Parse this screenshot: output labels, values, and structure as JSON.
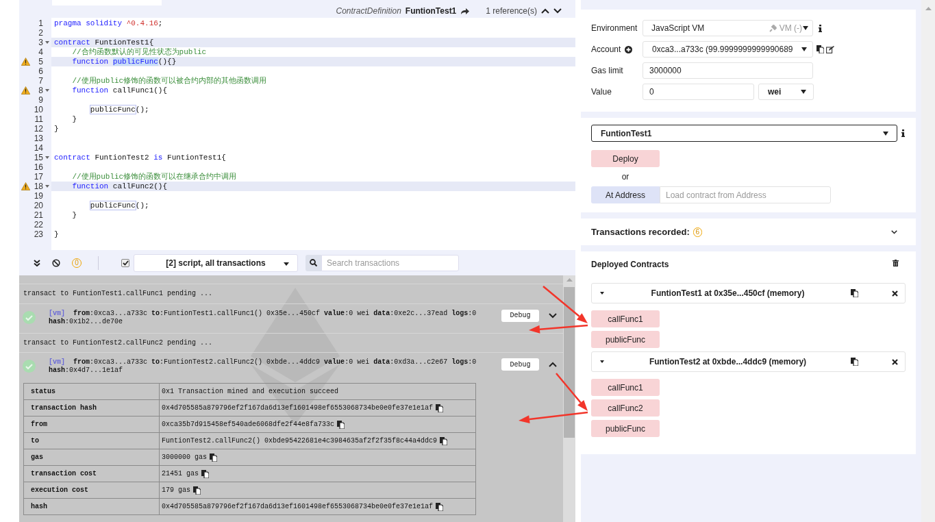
{
  "editor": {
    "header": {
      "kind_label": "ContractDefinition",
      "name": "FuntionTest1",
      "references": "1 reference(s)"
    },
    "lines": [
      {
        "number": "1",
        "warning": false,
        "fold": false,
        "highlighted": false,
        "tokens": [
          {
            "kind": "keyword",
            "text": "pragma solidity "
          },
          {
            "kind": "number",
            "text": "^0.4.16"
          },
          {
            "kind": "plain",
            "text": ";"
          }
        ]
      },
      {
        "number": "2",
        "warning": false,
        "fold": false,
        "highlighted": false
      },
      {
        "number": "3",
        "warning": false,
        "fold": true,
        "highlighted": true,
        "tokens": [
          {
            "kind": "keyword",
            "text": "contract "
          },
          {
            "kind": "plain",
            "text": "FuntionTest1{"
          }
        ]
      },
      {
        "number": "4",
        "warning": false,
        "fold": false,
        "highlighted": false,
        "tokens": [
          {
            "kind": "comment",
            "text": "    //合约函数默认的可见性状态为public"
          }
        ]
      },
      {
        "number": "5",
        "warning": true,
        "fold": false,
        "highlighted": true,
        "tokens": [
          {
            "kind": "keyword",
            "text": "    function "
          },
          {
            "kind": "selected",
            "text": "publicFunc"
          },
          {
            "kind": "plain",
            "text": "(){}"
          }
        ]
      },
      {
        "number": "6",
        "warning": false,
        "fold": false,
        "highlighted": false
      },
      {
        "number": "7",
        "warning": false,
        "fold": false,
        "highlighted": false,
        "tokens": [
          {
            "kind": "comment",
            "text": "    //使用public修饰的函数可以被合约内部的其他函数调用"
          }
        ]
      },
      {
        "number": "8",
        "warning": true,
        "fold": true,
        "highlighted": false,
        "tokens": [
          {
            "kind": "keyword",
            "text": "    function "
          },
          {
            "kind": "plain",
            "text": "callFunc1(){"
          }
        ]
      },
      {
        "number": "9",
        "warning": false,
        "fold": false,
        "highlighted": false
      },
      {
        "number": "10",
        "warning": false,
        "fold": false,
        "highlighted": false,
        "tokens": [
          {
            "kind": "occurrence",
            "text": "        publicFunc"
          },
          {
            "kind": "plain",
            "text": "();"
          }
        ]
      },
      {
        "number": "11",
        "warning": false,
        "fold": false,
        "highlighted": false,
        "tokens": [
          {
            "kind": "plain",
            "text": "    }"
          }
        ]
      },
      {
        "number": "12",
        "warning": false,
        "fold": false,
        "highlighted": false,
        "tokens": [
          {
            "kind": "plain",
            "text": "}"
          }
        ]
      },
      {
        "number": "13",
        "warning": false,
        "fold": false,
        "highlighted": false
      },
      {
        "number": "14",
        "warning": false,
        "fold": false,
        "highlighted": false
      },
      {
        "number": "15",
        "warning": false,
        "fold": true,
        "highlighted": false,
        "tokens": [
          {
            "kind": "keyword",
            "text": "contract "
          },
          {
            "kind": "plain",
            "text": "FuntionTest2 "
          },
          {
            "kind": "keyword",
            "text": "is "
          },
          {
            "kind": "plain",
            "text": "FuntionTest1{"
          }
        ]
      },
      {
        "number": "16",
        "warning": false,
        "fold": false,
        "highlighted": false
      },
      {
        "number": "17",
        "warning": false,
        "fold": false,
        "highlighted": false,
        "tokens": [
          {
            "kind": "comment",
            "text": "    //使用public修饰的函数可以在继承合约中调用"
          }
        ]
      },
      {
        "number": "18",
        "warning": true,
        "fold": true,
        "highlighted": true,
        "tokens": [
          {
            "kind": "keyword",
            "text": "    function "
          },
          {
            "kind": "plain",
            "text": "callFunc2(){"
          }
        ]
      },
      {
        "number": "19",
        "warning": false,
        "fold": false,
        "highlighted": false
      },
      {
        "number": "20",
        "warning": false,
        "fold": false,
        "highlighted": false,
        "tokens": [
          {
            "kind": "occurrence",
            "text": "        publicFunc"
          },
          {
            "kind": "plain",
            "text": "();"
          }
        ]
      },
      {
        "number": "21",
        "warning": false,
        "fold": false,
        "highlighted": false,
        "tokens": [
          {
            "kind": "plain",
            "text": "    }"
          }
        ]
      },
      {
        "number": "22",
        "warning": false,
        "fold": false,
        "highlighted": false
      },
      {
        "number": "23",
        "warning": false,
        "fold": false,
        "highlighted": false,
        "tokens": [
          {
            "kind": "plain",
            "text": "}"
          }
        ]
      }
    ]
  },
  "terminal": {
    "toolbar": {
      "pending_count": "0",
      "listen_checked": true,
      "filter": "[2] script, all transactions",
      "search_placeholder": "Search transactions"
    },
    "entries": [
      {
        "kind": "pending",
        "text": "transact to FuntionTest1.callFunc1 pending ..."
      },
      {
        "kind": "tx",
        "tag": "[vm]",
        "summary": "**from**:0xca3...a733c **to**:FuntionTest1.callFunc1() 0x35e...450cf **value**:0 wei **data**:0xe2c...37ead **logs**:0 **hash**:0x1b2...de70e",
        "button": "Debug",
        "expanded": false
      },
      {
        "kind": "pending",
        "text": "transact to FuntionTest2.callFunc2 pending ..."
      },
      {
        "kind": "tx",
        "tag": "[vm]",
        "summary": "**from**:0xca3...a733c **to**:FuntionTest2.callFunc2() 0xbde...4ddc9 **value**:0 wei **data**:0xd3a...c2e67 **logs**:0 **hash**:0x4d7...1e1af",
        "button": "Debug",
        "expanded": true,
        "details": [
          {
            "key": "status",
            "value": "0x1 Transaction mined and execution succeed",
            "copy": false
          },
          {
            "key": "transaction hash",
            "value": "0x4d705585a879796ef2f167da6d13ef1601498ef6553068734be0e0fe37e1e1af",
            "copy": true
          },
          {
            "key": "from",
            "value": "0xca35b7d915458ef540ade6068dfe2f44e8fa733c",
            "copy": true
          },
          {
            "key": "to",
            "value": "FuntionTest2.callFunc2() 0xbde95422681e4c3984635af2f2f35f8c44a4ddc9",
            "copy": true
          },
          {
            "key": "gas",
            "value": "3000000 gas",
            "copy": true
          },
          {
            "key": "transaction cost",
            "value": "21451 gas",
            "copy": true
          },
          {
            "key": "execution cost",
            "value": "179 gas",
            "copy": true
          },
          {
            "key": "hash",
            "value": "0x4d705585a879796ef2f167da6d13ef1601498ef6553068734be0e0fe37e1e1af",
            "copy": true
          }
        ]
      }
    ]
  },
  "run": {
    "environment": {
      "label": "Environment",
      "value": "JavaScript VM",
      "network": "VM (-)"
    },
    "account": {
      "label": "Account",
      "value": "0xca3...a733c (99.9999999999990689"
    },
    "gas_limit": {
      "label": "Gas limit",
      "value": "3000000"
    },
    "value": {
      "label": "Value",
      "amount": "0",
      "unit": "wei"
    },
    "contract": "FuntionTest1",
    "deploy": "Deploy",
    "or": "or",
    "at_address": "At Address",
    "address_placeholder": "Load contract from Address",
    "transactions_recorded": {
      "label": "Transactions recorded:",
      "count": "6",
      "expanded": false
    },
    "deployed": {
      "title": "Deployed Contracts",
      "instances": [
        {
          "title": "FuntionTest1 at 0x35e...450cf (memory)",
          "expanded": true,
          "functions": [
            "callFunc1",
            "publicFunc"
          ]
        },
        {
          "title": "FuntionTest2 at 0xbde...4ddc9 (memory)",
          "expanded": true,
          "functions": [
            "callFunc1",
            "callFunc2",
            "publicFunc"
          ]
        }
      ]
    }
  }
}
